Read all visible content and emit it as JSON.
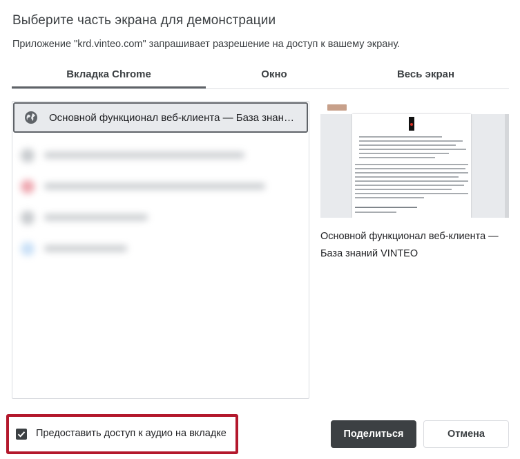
{
  "dialog": {
    "title": "Выберите часть экрана для демонстрации",
    "subtitle": "Приложение \"krd.vinteo.com\" запрашивает разрешение на доступ к вашему экрану."
  },
  "tabs": [
    {
      "label": "Вкладка Chrome",
      "active": true
    },
    {
      "label": "Окно",
      "active": false
    },
    {
      "label": "Весь экран",
      "active": false
    }
  ],
  "tab_list": {
    "selected_item": {
      "icon": "globe-icon",
      "title": "Основной функционал веб-клиента — База знаний VINTEO"
    }
  },
  "preview": {
    "title": "Основной функционал веб-клиента — База знаний VINTEO"
  },
  "audio": {
    "checked": true,
    "label": "Предоставить доступ к аудио на вкладке"
  },
  "buttons": {
    "share": "Поделиться",
    "cancel": "Отмена"
  },
  "colors": {
    "accent": "#3c4043",
    "highlight_border": "#b3182c",
    "selected_bg": "#e8eaed"
  }
}
